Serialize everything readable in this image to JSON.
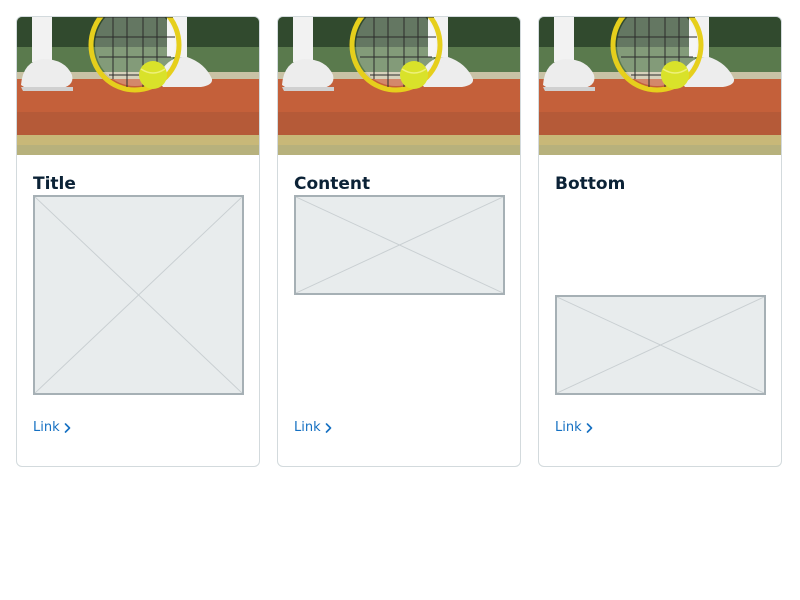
{
  "cards": [
    {
      "title": "Title",
      "link_label": "Link",
      "image_icon": "tennis-photo",
      "placeholder_icon": "image-placeholder-icon",
      "link_icon": "chevron-right-icon"
    },
    {
      "title": "Content",
      "link_label": "Link",
      "image_icon": "tennis-photo",
      "placeholder_icon": "image-placeholder-icon",
      "link_icon": "chevron-right-icon"
    },
    {
      "title": "Bottom",
      "link_label": "Link",
      "image_icon": "tennis-photo",
      "placeholder_icon": "image-placeholder-icon",
      "link_icon": "chevron-right-icon"
    }
  ],
  "colors": {
    "title": "#0b2236",
    "link": "#1570c2",
    "card_border": "#d3dadd",
    "placeholder_fill": "#e8eced",
    "placeholder_border": "#a6b0b5",
    "court_clay": "#c4603a",
    "ball": "#d9e22a"
  }
}
